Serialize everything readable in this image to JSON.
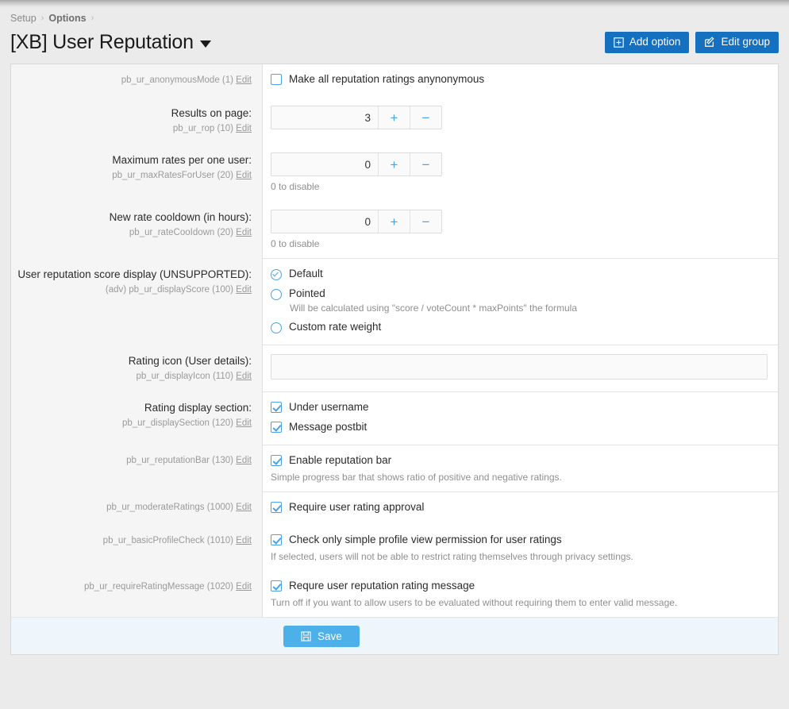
{
  "breadcrumb": {
    "items": [
      "Setup",
      "Options"
    ],
    "separator": "›"
  },
  "header": {
    "title": "[XB] User Reputation",
    "dropdown_icon": "caret-down-icon",
    "buttons": [
      {
        "label": "Add option",
        "icon": "plus-square-icon"
      },
      {
        "label": "Edit group",
        "icon": "pencil-square-icon"
      }
    ]
  },
  "rows": [
    {
      "label_title": "",
      "label_meta": "pb_ur_anonymousMode (1)",
      "edit_label": "Edit",
      "control": "checkbox",
      "checkbox_label": "Make all reputation ratings anynonymous",
      "checked": false
    },
    {
      "label_title": "Results on page:",
      "label_meta": "pb_ur_rop (10)",
      "edit_label": "Edit",
      "control": "stepper",
      "value": "3",
      "plus": "+",
      "minus": "−",
      "hint": ""
    },
    {
      "label_title": "Maximum rates per one user:",
      "label_meta": "pb_ur_maxRatesForUser (20)",
      "edit_label": "Edit",
      "control": "stepper",
      "value": "0",
      "plus": "+",
      "minus": "−",
      "hint": "0 to disable"
    },
    {
      "label_title": "New rate cooldown (in hours):",
      "label_meta": "pb_ur_rateCooIdown (20)",
      "edit_label": "Edit",
      "control": "stepper",
      "value": "0",
      "plus": "+",
      "minus": "−",
      "hint": "0 to disable"
    },
    {
      "label_title": "User reputation score display (UNSUPPORTED):",
      "label_meta": "(adv) pb_ur_displayScore (100)",
      "edit_label": "Edit",
      "control": "radio-group",
      "options": [
        {
          "label": "Default",
          "checked": true,
          "hint": ""
        },
        {
          "label": "Pointed",
          "checked": false,
          "hint": "Will be calculated using \"score / voteCount * maxPoints\" the formula"
        },
        {
          "label": "Custom rate weight",
          "checked": false,
          "hint": ""
        }
      ]
    },
    {
      "label_title": "Rating icon (User details):",
      "label_meta": "pb_ur_displayIcon (110)",
      "edit_label": "Edit",
      "control": "text",
      "value": "",
      "placeholder": ""
    },
    {
      "label_title": "Rating display section:",
      "label_meta": "pb_ur_displaySection (120)",
      "edit_label": "Edit",
      "control": "checkbox-group",
      "options": [
        {
          "label": "Under username",
          "checked": true
        },
        {
          "label": "Message postbit",
          "checked": true
        }
      ]
    },
    {
      "label_title": "",
      "label_meta": "pb_ur_reputationBar (130)",
      "edit_label": "Edit",
      "control": "checkbox",
      "checkbox_label": "Enable reputation bar",
      "checked": true,
      "hint": "Simple progress bar that shows ratio of positive and negative ratings."
    },
    {
      "label_title": "",
      "label_meta": "pb_ur_moderateRatings (1000)",
      "edit_label": "Edit",
      "control": "checkbox",
      "checkbox_label": "Require user rating approval",
      "checked": true,
      "hint": "",
      "divider": true
    },
    {
      "label_title": "",
      "label_meta": "pb_ur_basicProfileCheck (1010)",
      "edit_label": "Edit",
      "control": "checkbox",
      "checkbox_label": "Check only simple profile view permission for user ratings",
      "checked": true,
      "hint": "If selected, users will not be able to restrict rating themselves through privacy settings."
    },
    {
      "label_title": "",
      "label_meta": "pb_ur_requireRatingMessage (1020)",
      "edit_label": "Edit",
      "control": "checkbox",
      "checkbox_label": "Requre user reputation rating message",
      "checked": true,
      "hint": "Turn off if you want to allow users to be evaluated without requiring them to enter valid message."
    }
  ],
  "footer": {
    "save_label": "Save",
    "save_icon": "floppy-disk-icon"
  },
  "colors": {
    "accent_dark_blue": "#1570bf",
    "accent_light_blue": "#4eb0e8",
    "control_blue": "#4ba3e3",
    "label_bg": "#f5f5f5",
    "footer_bg": "#eef6fb",
    "page_bg": "#ebebeb"
  }
}
